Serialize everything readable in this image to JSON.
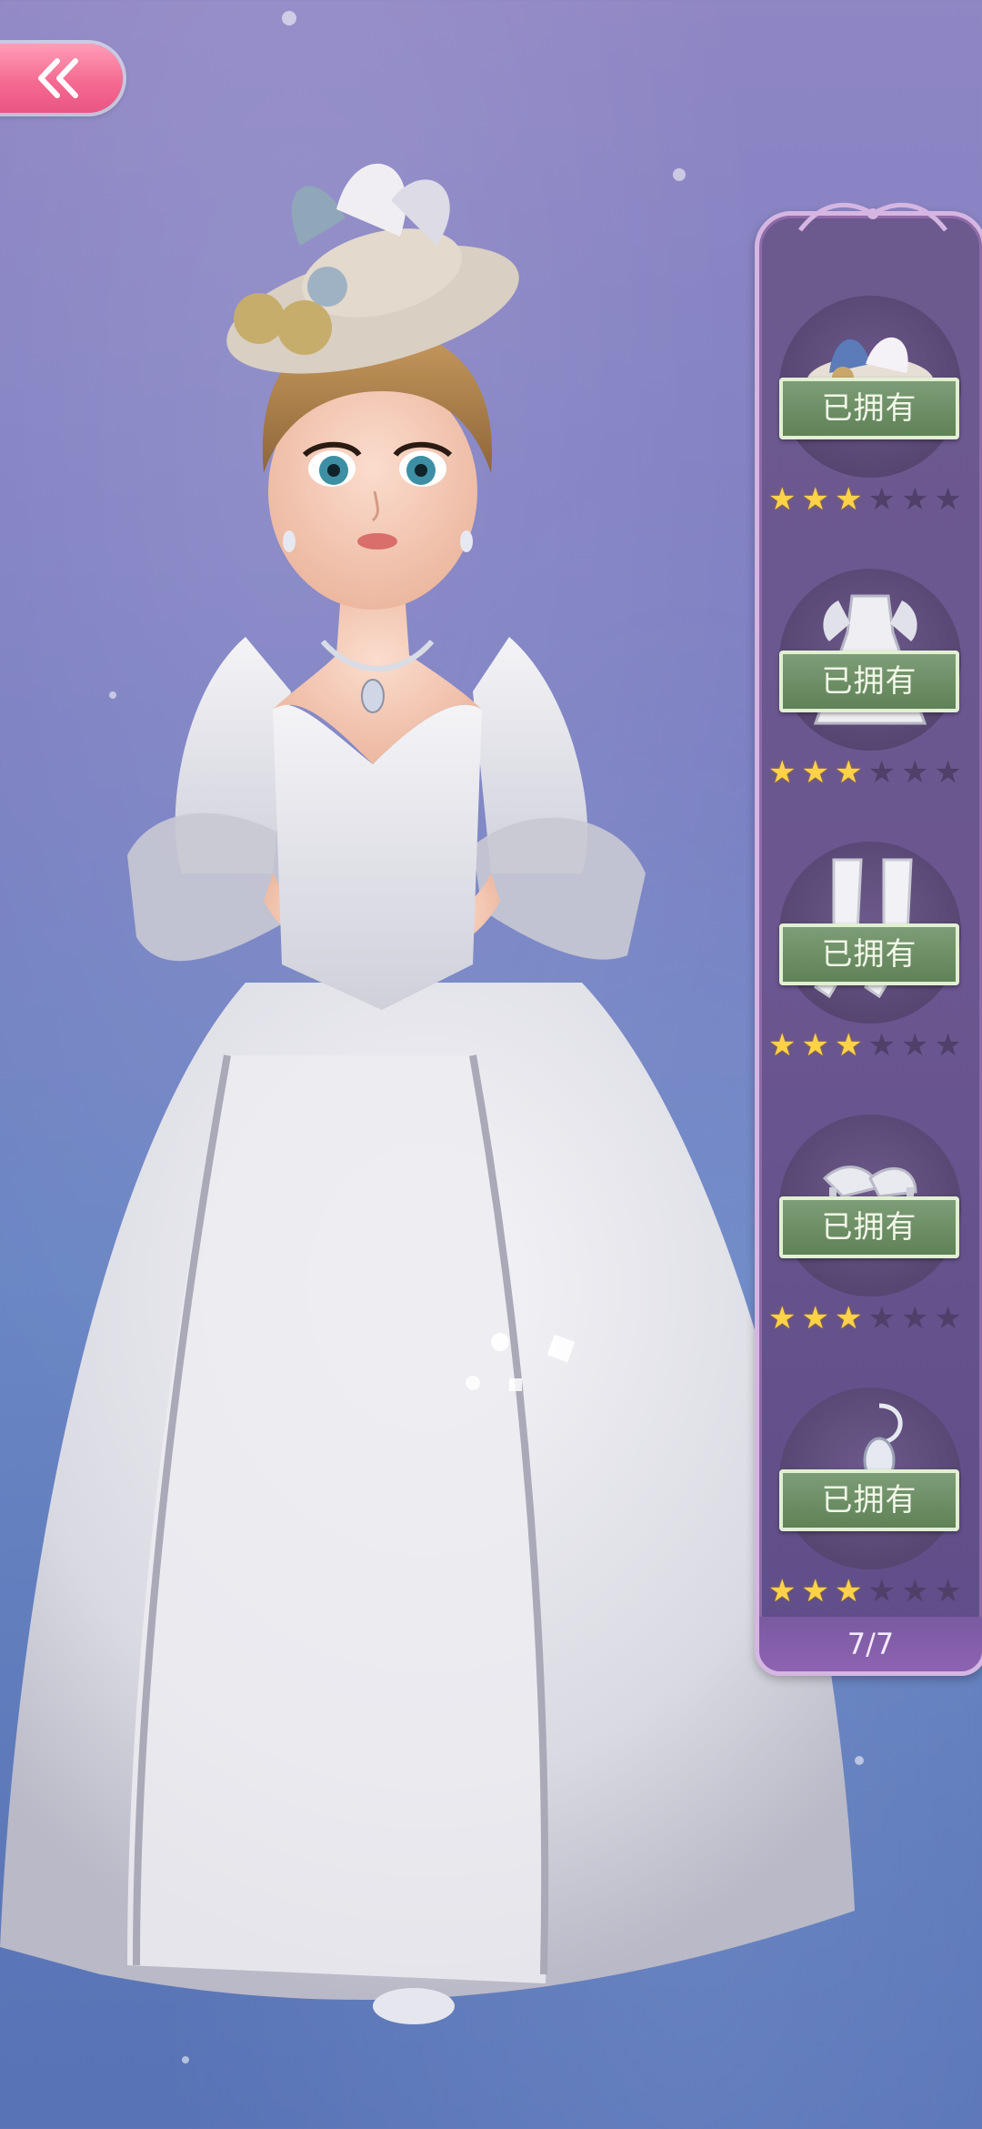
{
  "nav": {
    "back_icon": "double-chevron-left-icon"
  },
  "outfit_panel": {
    "items": [
      {
        "category": "hat-icon",
        "status": "已拥有",
        "stars": 3,
        "max_stars": 6
      },
      {
        "category": "dress-icon",
        "status": "已拥有",
        "stars": 3,
        "max_stars": 6
      },
      {
        "category": "stockings-icon",
        "status": "已拥有",
        "stars": 3,
        "max_stars": 6
      },
      {
        "category": "shoes-icon",
        "status": "已拥有",
        "stars": 3,
        "max_stars": 6
      },
      {
        "category": "earrings-icon",
        "status": "已拥有",
        "stars": 3,
        "max_stars": 6
      }
    ],
    "counter": "7/7"
  },
  "colors": {
    "back_button": "#f56b92",
    "badge": "#5f8257",
    "star_on": "#ffd24a",
    "panel": "#6b5690"
  }
}
